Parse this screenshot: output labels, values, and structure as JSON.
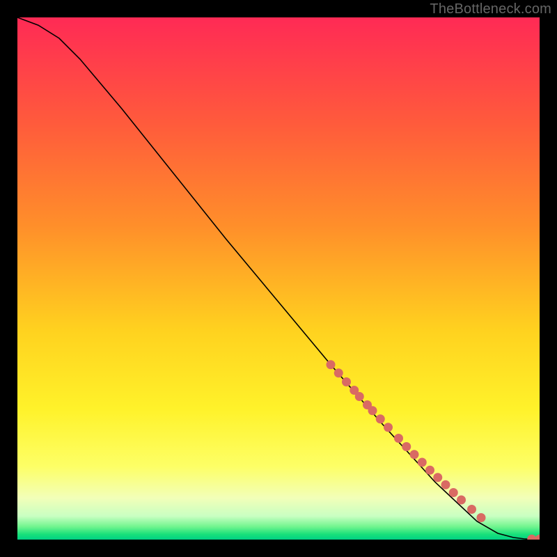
{
  "watermark": "TheBottleneck.com",
  "chart_data": {
    "type": "line",
    "title": "",
    "xlabel": "",
    "ylabel": "",
    "xlim": [
      0,
      100
    ],
    "ylim": [
      0,
      100
    ],
    "grid": false,
    "legend": false,
    "background": "rainbow-gradient-red-to-green",
    "gradient_stops": [
      {
        "pos": 0.0,
        "color": "#ff2a55"
      },
      {
        "pos": 0.2,
        "color": "#ff5a3c"
      },
      {
        "pos": 0.4,
        "color": "#ff8f2a"
      },
      {
        "pos": 0.6,
        "color": "#ffd21f"
      },
      {
        "pos": 0.75,
        "color": "#fff22a"
      },
      {
        "pos": 0.86,
        "color": "#fdff66"
      },
      {
        "pos": 0.92,
        "color": "#f2ffb8"
      },
      {
        "pos": 0.955,
        "color": "#c9ffc2"
      },
      {
        "pos": 0.975,
        "color": "#72f58f"
      },
      {
        "pos": 0.99,
        "color": "#18e07a"
      },
      {
        "pos": 1.0,
        "color": "#00d184"
      }
    ],
    "series": [
      {
        "name": "curve",
        "style": "line-black",
        "x": [
          0,
          4,
          8,
          12,
          20,
          30,
          40,
          50,
          60,
          70,
          80,
          88,
          92,
          95,
          97,
          98.5,
          100
        ],
        "y": [
          100,
          98.5,
          96,
          92,
          82.5,
          70,
          57.5,
          45.5,
          33.5,
          22,
          11,
          3.5,
          1.2,
          0.4,
          0.15,
          0.05,
          0.05
        ]
      },
      {
        "name": "dots-on-curve",
        "style": "scatter-salmon",
        "x": [
          60,
          61.5,
          63,
          64.5,
          65.5,
          67,
          68,
          69.5,
          71,
          73,
          74.5,
          76,
          77.5,
          79,
          80.5,
          82,
          83.5,
          85,
          87,
          88.8,
          98.5,
          100
        ],
        "y": [
          33.5,
          31.9,
          30.2,
          28.6,
          27.4,
          25.8,
          24.7,
          23.1,
          21.5,
          19.4,
          17.8,
          16.3,
          14.8,
          13.3,
          11.9,
          10.5,
          9.0,
          7.6,
          5.8,
          4.2,
          0.1,
          0.1
        ]
      }
    ]
  }
}
